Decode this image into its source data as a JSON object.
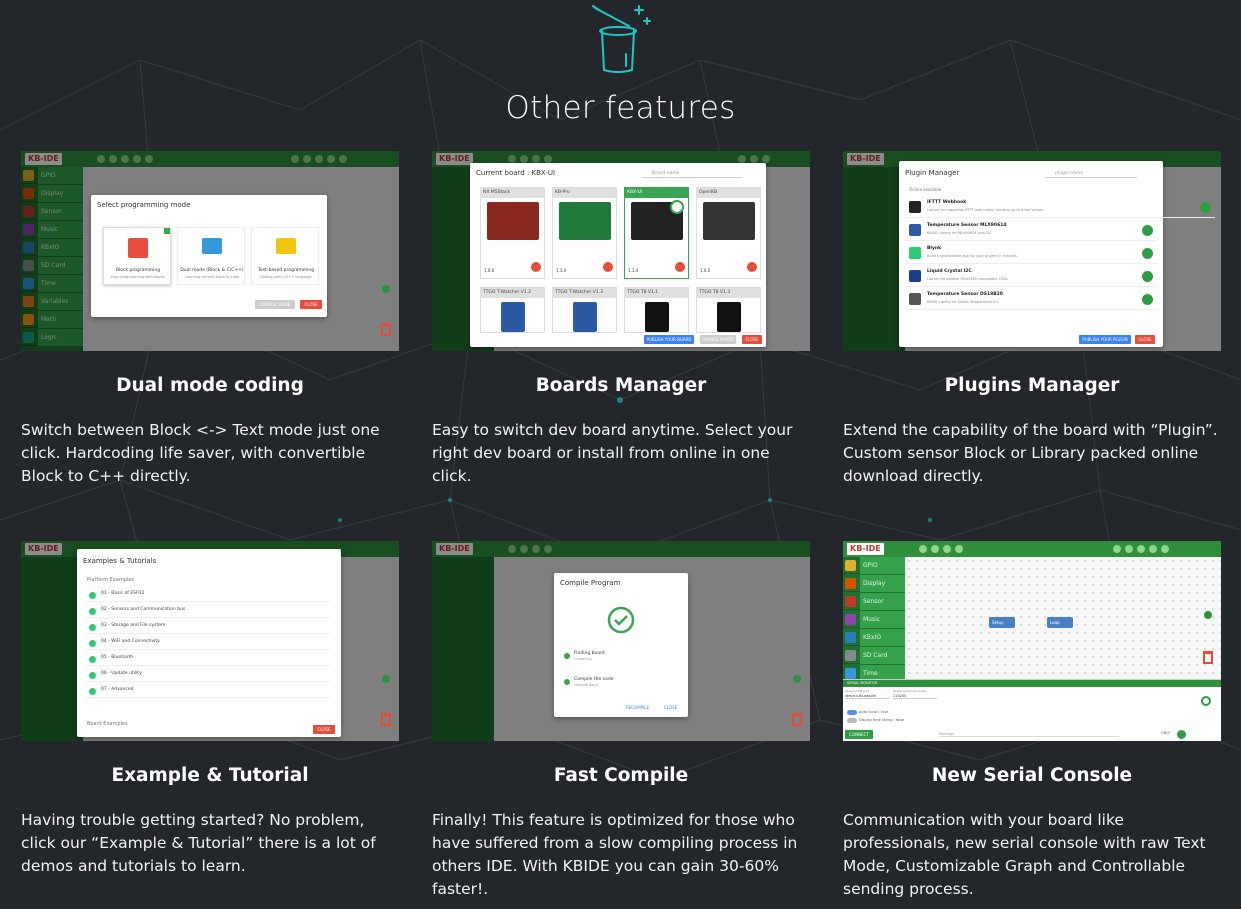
{
  "section": {
    "title": "Other features",
    "icon": "magic-hat-icon"
  },
  "colors": {
    "background": "#23272c",
    "accent": "#1fc6c6",
    "ide_green": "#2f8f3d"
  },
  "ide": {
    "logo": "KB-IDE",
    "sidebar": [
      "GPIO",
      "Display",
      "Sensor",
      "Music",
      "KBxIO",
      "SD Card",
      "Time",
      "Variables",
      "Math",
      "Logic"
    ]
  },
  "features": [
    {
      "title": "Dual mode coding",
      "description": "Switch between Block <-> Text mode just one click. Hardcoding life saver, with convertible Block to C++ directly.",
      "screenshot": {
        "dialog_title": "Select programming mode",
        "options": [
          {
            "label": "Block programming",
            "sub": "Easy programming with blocks"
          },
          {
            "label": "Dual mode (Block & C/C++)",
            "sub": "Learning convert block to code"
          },
          {
            "label": "Text-based programming",
            "sub": "Coding with C/C++ language"
          }
        ],
        "buttons": [
          "CHANGE MODE",
          "CLOSE"
        ]
      }
    },
    {
      "title": "Boards Manager",
      "description": "Easy to switch dev board anytime. Select your right dev board or install from online in one click.",
      "screenshot": {
        "dialog_title": "Current board : KBX-UI",
        "search_placeholder": "Board name",
        "boards": [
          "NX M5Stack",
          "KB-Pro",
          "KBX-UI",
          "OpenKB",
          "TTGO T-Watcher V1.2",
          "TTGO T-Watcher V1.3",
          "TTGO T8 V1.1",
          "TTGO T8 V1.3"
        ],
        "versions": [
          "1.0.0",
          "1.3.0",
          "1.1.4",
          "1.0.5"
        ],
        "buttons": [
          "PUBLISH YOUR BOARD",
          "CHANGE BOARD",
          "CLOSE"
        ]
      }
    },
    {
      "title": "Plugins Manager",
      "description": "Extend the capability of the board with “Plugin”. Custom sensor Block or Library packed online download directly.",
      "screenshot": {
        "dialog_title": "Plugin Manager",
        "search_placeholder": "plugin name",
        "list_label": "Online available",
        "plugins": [
          {
            "name": "IFTTT Webhook",
            "desc": "Library for triggering IFTTT web hooks, sending up to three values."
          },
          {
            "name": "Temperature Sensor MLX90614",
            "desc": "KBIDE Library for MLX90614 plus I2C"
          },
          {
            "name": "Blynk",
            "desc": "Build a smartphone app for your project in minutes."
          },
          {
            "name": "Liquid Crystal I2C",
            "desc": "Library for parallel HD44780 compatible LCDs"
          },
          {
            "name": "Temperature Sensor DS18B20",
            "desc": "KBIDE Library for Dallas Temperature ICs"
          }
        ],
        "buttons": [
          "PUBLISH YOUR PLUGIN",
          "CLOSE"
        ]
      }
    },
    {
      "title": "Example & Tutorial",
      "description": "Having trouble getting started? No problem, click our “Example & Tutorial” there is a lot of demos and tutorials to learn.",
      "screenshot": {
        "dialog_title": "Examples & Tutorials",
        "group_platform": "Platform Examples",
        "group_board": "Board Examples",
        "items": [
          "01 - Basic of ESP32",
          "02 - Sensors and Communication bus",
          "03 - Storage and File system",
          "04 - WiFi and Connectivity",
          "05 - Bluetooth",
          "06 - Update utility",
          "07 - Advanced"
        ],
        "buttons": [
          "CLOSE"
        ]
      }
    },
    {
      "title": "Fast Compile",
      "description": "Finally! This feature is optimized for those who have suffered from a slow compiling process in others IDE. With KBIDE you can gain 30-60% faster!.",
      "screenshot": {
        "dialog_title": "Compile Program",
        "steps": [
          {
            "label": "Finding board",
            "sub": "Compiling"
          },
          {
            "label": "Compile the code",
            "sub": "compile done"
          }
        ],
        "buttons": [
          "RECOMPILE",
          "CLOSE"
        ]
      }
    },
    {
      "title": "New Serial Console",
      "description": "Communication with your board like professionals, new serial console with raw Text Mode, Customizable Graph and Controllable sending process.",
      "screenshot": {
        "blocks": [
          "Setup",
          "Loop"
        ],
        "panel_title": "SERIAL MONITOR",
        "port_label": "Select COM port",
        "port_value": "/dev/cu.Bluetooth",
        "baud_label": "Serial speed baudrate",
        "baud_value": "115200",
        "autoscroll": "Auto Scroll : true",
        "timestamp": "Display time String : false",
        "connect": "CONNECT",
        "message_placeholder": "Message",
        "line_end": "ONLF"
      }
    }
  ]
}
